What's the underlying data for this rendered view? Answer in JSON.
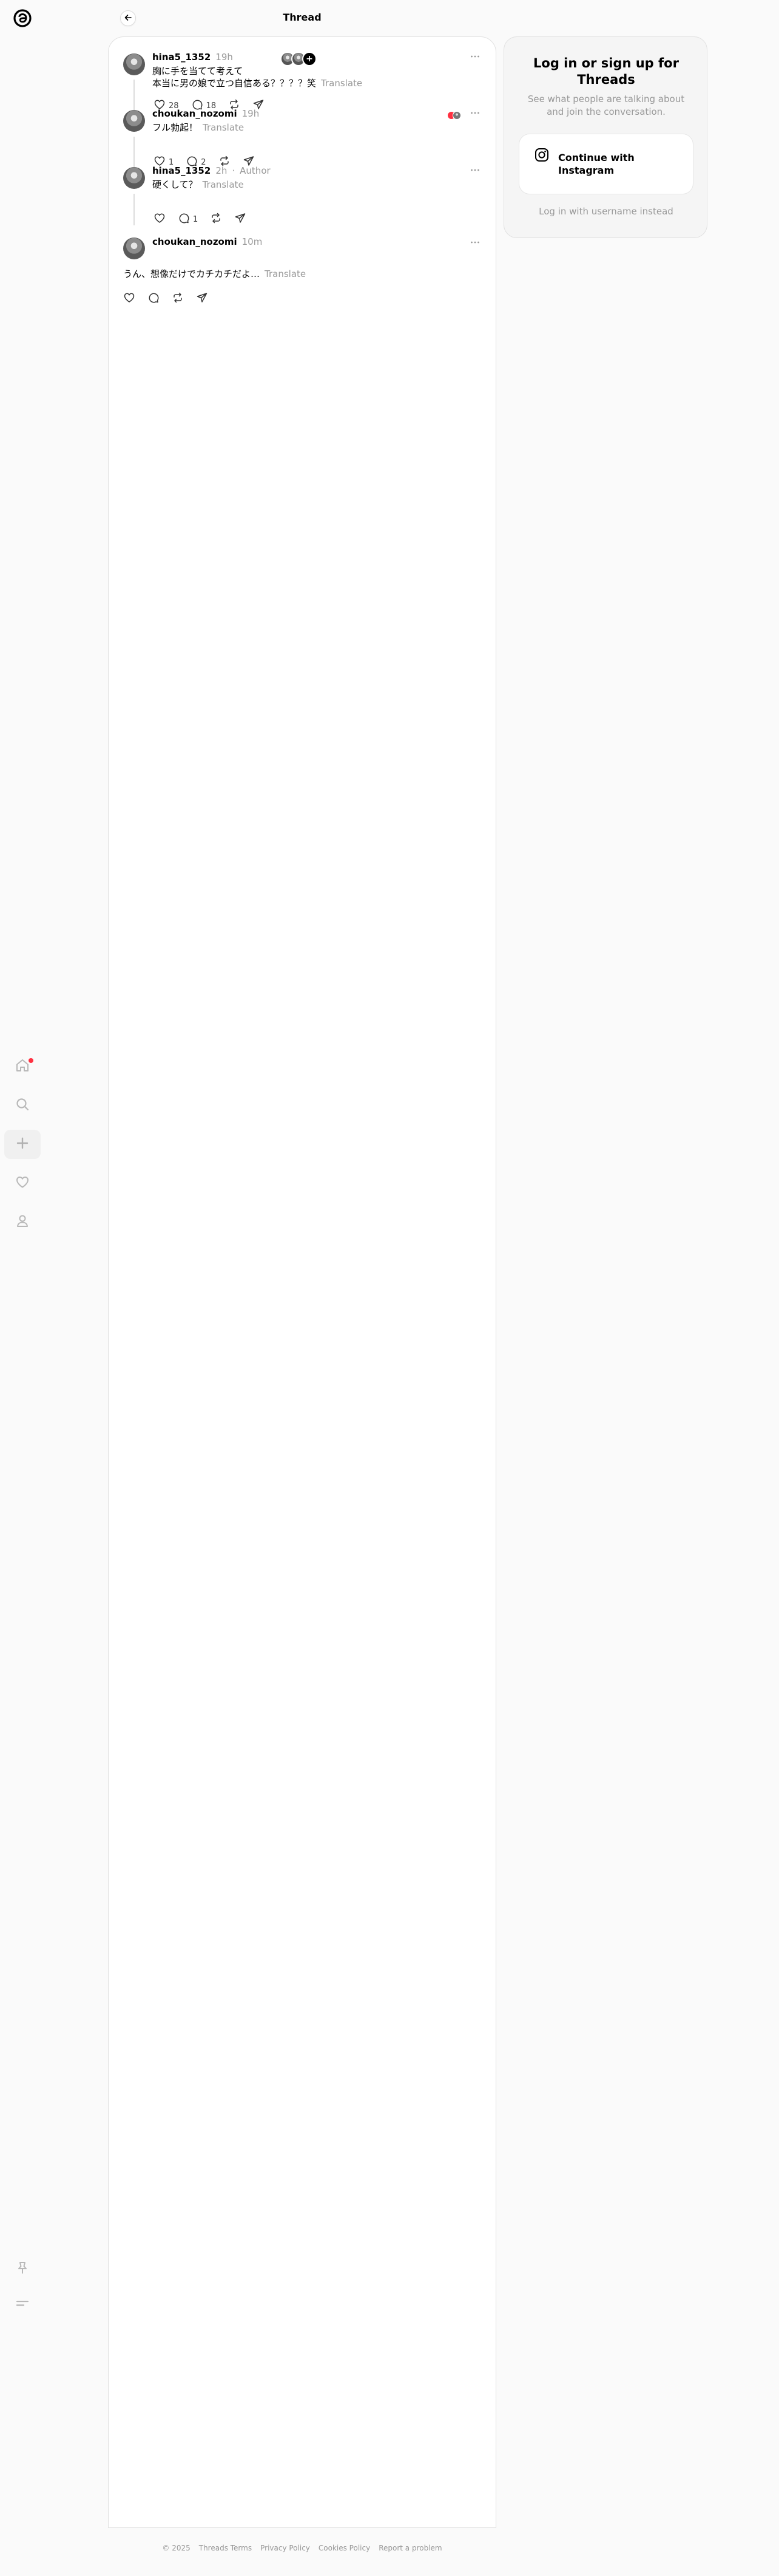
{
  "header": {
    "title": "Thread"
  },
  "posts": [
    {
      "username": "hina5_1352",
      "time": "19h",
      "lines": [
        "胸に手を当てて考えて",
        "本当に男の娘で立つ自信ある？？？？笑"
      ],
      "translate": "Translate",
      "likes": "28",
      "replies": "18",
      "facepile_plus": "+"
    },
    {
      "username": "choukan_nozomi",
      "time": "19h",
      "text": "フル勃起！",
      "translate": "Translate",
      "likes": "1",
      "replies": "2"
    },
    {
      "username": "hina5_1352",
      "time": "2h",
      "author_separator": "·",
      "author_label": "Author",
      "text": "硬くして？",
      "translate": "Translate",
      "replies": "1"
    },
    {
      "username": "choukan_nozomi",
      "time": "10m",
      "text": "うん、想像だけでカチカチだよ…",
      "translate": "Translate"
    }
  ],
  "login": {
    "title": "Log in or sign up for Threads",
    "subtitle": "See what people are talking about and join the conversation.",
    "instagram_button": "Continue with Instagram",
    "alt_link": "Log in with username instead"
  },
  "footer": {
    "copyright": "© 2025",
    "terms": "Threads Terms",
    "privacy": "Privacy Policy",
    "cookies": "Cookies Policy",
    "report": "Report a problem"
  },
  "icons": {
    "logo": "threads-logo-icon",
    "home": "home-icon",
    "search": "search-icon",
    "create": "plus-icon",
    "activity": "heart-icon",
    "profile": "profile-icon",
    "pin": "pin-icon",
    "menu": "menu-icon"
  },
  "colors": {
    "notification_dot": "#ff3040",
    "muted_text": "#999999",
    "card_bg": "#ffffff",
    "page_bg": "#fafafa"
  }
}
